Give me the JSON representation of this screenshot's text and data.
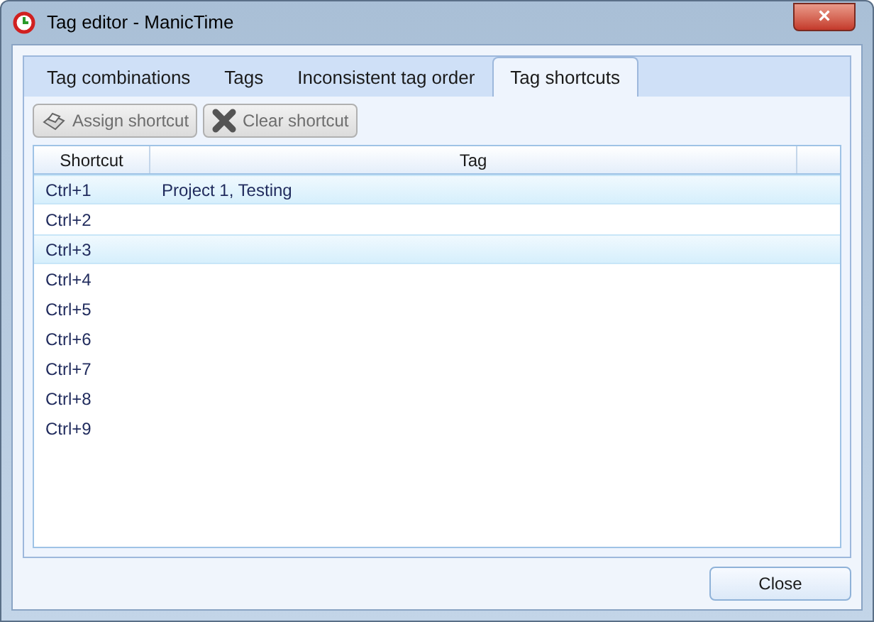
{
  "window": {
    "title": "Tag editor - ManicTime",
    "close": "×"
  },
  "tabs": [
    {
      "label": "Tag combinations",
      "selected": false
    },
    {
      "label": "Tags",
      "selected": false
    },
    {
      "label": "Inconsistent tag order",
      "selected": false
    },
    {
      "label": "Tag shortcuts",
      "selected": true
    }
  ],
  "toolbar": [
    {
      "label": "Assign shortcut",
      "kind": "assign",
      "disabled": true
    },
    {
      "label": "Clear shortcut",
      "kind": "clear",
      "disabled": true
    }
  ],
  "table": {
    "columns": [
      "Shortcut",
      "Tag"
    ],
    "rows": [
      {
        "shortcut": "Ctrl+1",
        "tag": "Project 1, Testing",
        "selected": true
      },
      {
        "shortcut": "Ctrl+2",
        "selected": false
      },
      {
        "shortcut": "Ctrl+3",
        "selected": true
      },
      {
        "shortcut": "Ctrl+4",
        "selected": false
      },
      {
        "shortcut": "Ctrl+5",
        "selected": false
      },
      {
        "shortcut": "Ctrl+6",
        "selected": false
      },
      {
        "shortcut": "Ctrl+7",
        "selected": false
      },
      {
        "shortcut": "Ctrl+8",
        "selected": false
      },
      {
        "shortcut": "Ctrl+9",
        "selected": false
      }
    ]
  },
  "buttons": [
    {
      "label": "Close"
    }
  ]
}
